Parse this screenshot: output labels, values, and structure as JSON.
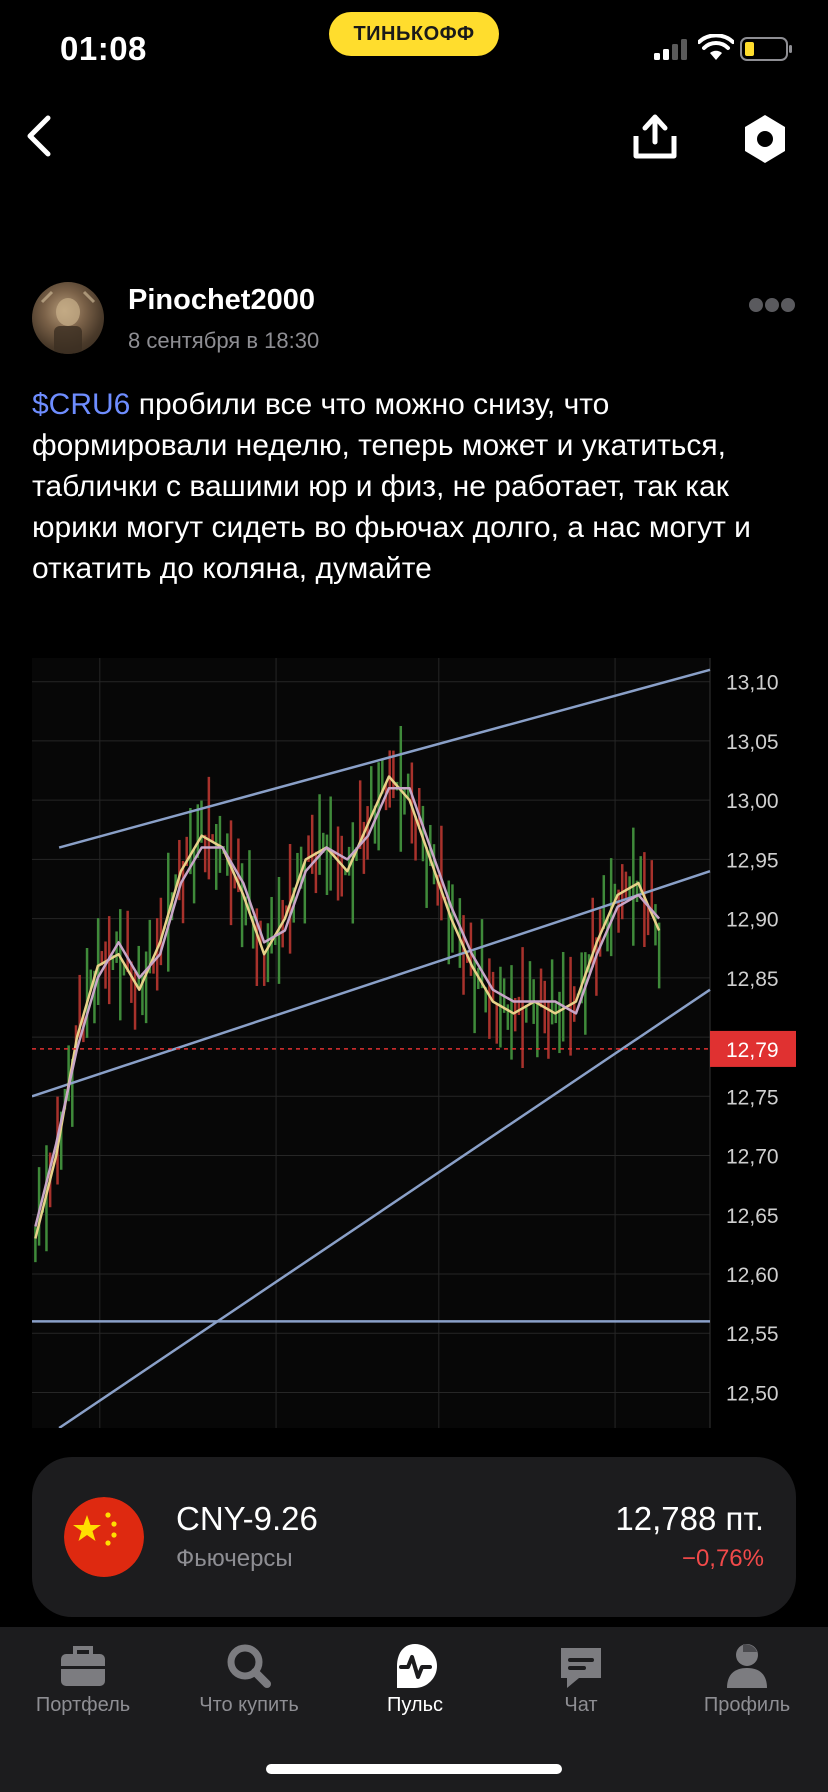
{
  "status_bar": {
    "time": "01:08",
    "brand": "ТИНЬКОФФ"
  },
  "author": {
    "name": "Pinochet2000",
    "date": "8 сентября в 18:30"
  },
  "post": {
    "ticker": "$CRU6",
    "text": " пробили все что можно снизу, что формировали неделю, теперь может и укатиться, таблички с вашими юр и физ, не работает, так как юрики могут сидеть во фьючах долго, а нас могут и откатить до коляна, думайте"
  },
  "chart_data": {
    "type": "line",
    "ylim": [
      12.47,
      13.12
    ],
    "y_ticks": [
      "13,10",
      "13,05",
      "13,00",
      "12,95",
      "12,90",
      "12,85",
      "12,80",
      "12,75",
      "12,70",
      "12,65",
      "12,60",
      "12,55",
      "12,50"
    ],
    "current_price_label": "12,79",
    "current_price": 12.79,
    "series": [
      {
        "color": "#e8d28a",
        "values": [
          12.63,
          12.7,
          12.8,
          12.86,
          12.87,
          12.84,
          12.88,
          12.94,
          12.97,
          12.96,
          12.92,
          12.87,
          12.9,
          12.95,
          12.96,
          12.94,
          12.98,
          13.02,
          13.0,
          12.95,
          12.9,
          12.86,
          12.83,
          12.82,
          12.83,
          12.82,
          12.83,
          12.88,
          12.92,
          12.93,
          12.89
        ]
      },
      {
        "color": "#c8a6c8",
        "values": [
          12.64,
          12.71,
          12.79,
          12.85,
          12.88,
          12.85,
          12.87,
          12.93,
          12.96,
          12.96,
          12.93,
          12.88,
          12.89,
          12.94,
          12.96,
          12.95,
          12.97,
          13.01,
          13.01,
          12.96,
          12.91,
          12.87,
          12.84,
          12.83,
          12.83,
          12.83,
          12.82,
          12.87,
          12.91,
          12.92,
          12.9
        ]
      }
    ],
    "trend_lines": [
      {
        "from": [
          0.04,
          12.96
        ],
        "to": [
          1.0,
          13.11
        ]
      },
      {
        "from": [
          0.0,
          12.75
        ],
        "to": [
          1.0,
          12.94
        ]
      },
      {
        "from": [
          0.04,
          12.47
        ],
        "to": [
          1.0,
          12.84
        ]
      },
      {
        "from": [
          0.0,
          12.56
        ],
        "to": [
          1.0,
          12.56
        ]
      }
    ],
    "title": "",
    "xlabel": "",
    "ylabel": ""
  },
  "instrument": {
    "name": "CNY-9.26",
    "type": "Фьючерсы",
    "price": "12,788 пт.",
    "change": "−0,76%"
  },
  "tabs": [
    {
      "label": "Портфель",
      "icon": "briefcase-icon",
      "active": false
    },
    {
      "label": "Что купить",
      "icon": "search-icon",
      "active": false
    },
    {
      "label": "Пульс",
      "icon": "pulse-icon",
      "active": true
    },
    {
      "label": "Чат",
      "icon": "chat-icon",
      "active": false
    },
    {
      "label": "Профиль",
      "icon": "profile-icon",
      "active": false
    }
  ],
  "colors": {
    "accent": "#FFDD2D",
    "link": "#6e8dff",
    "negative": "#f24a4a",
    "price_tag": "#e03131"
  }
}
